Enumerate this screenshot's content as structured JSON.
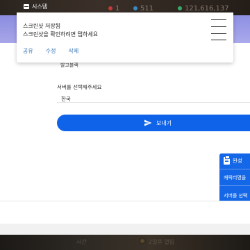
{
  "system_bar": {
    "label": "시스템",
    "stats": [
      "1",
      "511",
      "121,616,137"
    ]
  },
  "left_strip": {
    "text": ""
  },
  "notification": {
    "title": "스크린샷 저장됨",
    "text": "스크린샷을 확인하려면 탭하세요",
    "actions": [
      "공유",
      "수정",
      "삭제"
    ]
  },
  "form": {
    "nickname_value": "발고블랙",
    "server_label": "서버를 선택해주세요",
    "server_value": "한국",
    "send_label": "보내기"
  },
  "done_panel": {
    "title": "완성",
    "line1": "캐릭터명을",
    "line2": "서버를 선택"
  },
  "game_strip": {
    "left_text": "시간",
    "right_text": "2일후 열림"
  },
  "colors": {
    "accent": "#0e63e8",
    "panel_blue": "#1467e6",
    "link": "#3a78b8",
    "purple": "#8a8ce0"
  }
}
